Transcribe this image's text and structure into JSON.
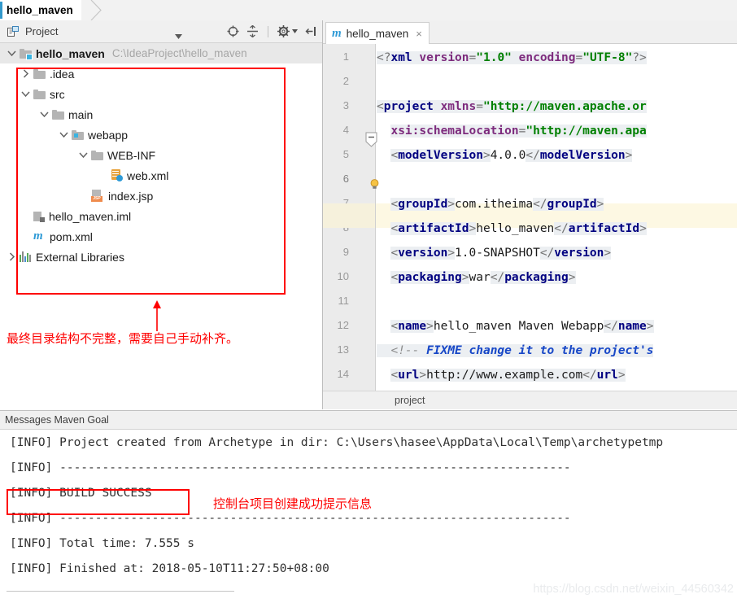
{
  "topbar": {
    "nav_tab": "hello_maven"
  },
  "project_panel": {
    "title": "Project",
    "icons": {
      "project_view_icon": "project-view-icon",
      "dropdown_caret": "chevron-down-icon",
      "locate_icon": "scroll-from-source-icon",
      "collapse_icon": "collapse-all-icon",
      "settings_icon": "gear-icon",
      "hide_icon": "hide-panel-icon"
    },
    "tree": [
      {
        "name": "hello_maven",
        "path": "C:\\IdeaProject\\hello_maven",
        "depth": 0,
        "arrow": "down",
        "icon": "module-icon",
        "bold": true,
        "selected": true
      },
      {
        "name": ".idea",
        "path": "",
        "depth": 1,
        "arrow": "right",
        "icon": "folder-icon",
        "bold": false,
        "selected": false
      },
      {
        "name": "src",
        "path": "",
        "depth": 1,
        "arrow": "down",
        "icon": "folder-icon",
        "bold": false,
        "selected": false
      },
      {
        "name": "main",
        "path": "",
        "depth": 2,
        "arrow": "down",
        "icon": "folder-icon",
        "bold": false,
        "selected": false
      },
      {
        "name": "webapp",
        "path": "",
        "depth": 3,
        "arrow": "down",
        "icon": "folder-web-icon",
        "bold": false,
        "selected": false
      },
      {
        "name": "WEB-INF",
        "path": "",
        "depth": 4,
        "arrow": "down",
        "icon": "folder-icon",
        "bold": false,
        "selected": false
      },
      {
        "name": "web.xml",
        "path": "",
        "depth": 5,
        "arrow": "none",
        "icon": "xml-file-icon",
        "bold": false,
        "selected": false
      },
      {
        "name": "index.jsp",
        "path": "",
        "depth": 4,
        "arrow": "none",
        "icon": "jsp-file-icon",
        "bold": false,
        "selected": false
      },
      {
        "name": "hello_maven.iml",
        "path": "",
        "depth": 1,
        "arrow": "none",
        "icon": "iml-file-icon",
        "bold": false,
        "selected": false
      },
      {
        "name": "pom.xml",
        "path": "",
        "depth": 1,
        "arrow": "none",
        "icon": "maven-file-icon",
        "bold": false,
        "selected": false
      },
      {
        "name": "External Libraries",
        "path": "",
        "depth": 0,
        "arrow": "right",
        "icon": "libraries-icon",
        "bold": false,
        "selected": false
      }
    ],
    "annotation": "最终目录结构不完整，需要自己手动补齐。"
  },
  "editor": {
    "tab_label": "hello_maven",
    "tab_icon": "maven-file-icon",
    "tab_close": "×",
    "breadcrumb": "project",
    "highlighted_line": 6,
    "lines": [
      {
        "n": 1,
        "text": "<?xml version=\"1.0\" encoding=\"UTF-8\"?>"
      },
      {
        "n": 2,
        "text": ""
      },
      {
        "n": 3,
        "text": "<project xmlns=\"http://maven.apache.or"
      },
      {
        "n": 4,
        "text": "  xsi:schemaLocation=\"http://maven.apa"
      },
      {
        "n": 5,
        "text": "  <modelVersion>4.0.0</modelVersion>"
      },
      {
        "n": 6,
        "text": ""
      },
      {
        "n": 7,
        "text": "  <groupId>com.itheima</groupId>"
      },
      {
        "n": 8,
        "text": "  <artifactId>hello_maven</artifactId>"
      },
      {
        "n": 9,
        "text": "  <version>1.0-SNAPSHOT</version>"
      },
      {
        "n": 10,
        "text": "  <packaging>war</packaging>"
      },
      {
        "n": 11,
        "text": ""
      },
      {
        "n": 12,
        "text": "  <name>hello_maven Maven Webapp</name>"
      },
      {
        "n": 13,
        "text": "  <!-- FIXME change it to the project's"
      },
      {
        "n": 14,
        "text": "  <url>http://www.example.com</url>"
      }
    ]
  },
  "messages": {
    "title": "Messages Maven Goal",
    "console_lines": [
      "[INFO] Project created from Archetype in dir: C:\\Users\\hasee\\AppData\\Local\\Temp\\archetypetmp",
      "[INFO] ------------------------------------------------------------------------",
      "[INFO] BUILD SUCCESS",
      "[INFO] ------------------------------------------------------------------------",
      "[INFO] Total time: 7.555 s",
      "[INFO] Finished at: 2018-05-10T11:27:50+08:00"
    ],
    "annotation": "控制台项目创建成功提示信息"
  },
  "watermark": "https://blog.csdn.net/weixin_44560342",
  "colors": {
    "annotation_red": "#fe0000",
    "accent_blue": "#3399cc",
    "maven_blue": "#2e9ad6",
    "highlight_line": "#fdf8e3",
    "xml_tag": "#000080",
    "xml_string": "#008000",
    "xml_attr": "#7d2b7d",
    "xml_comment_bold": "#1747c7"
  }
}
